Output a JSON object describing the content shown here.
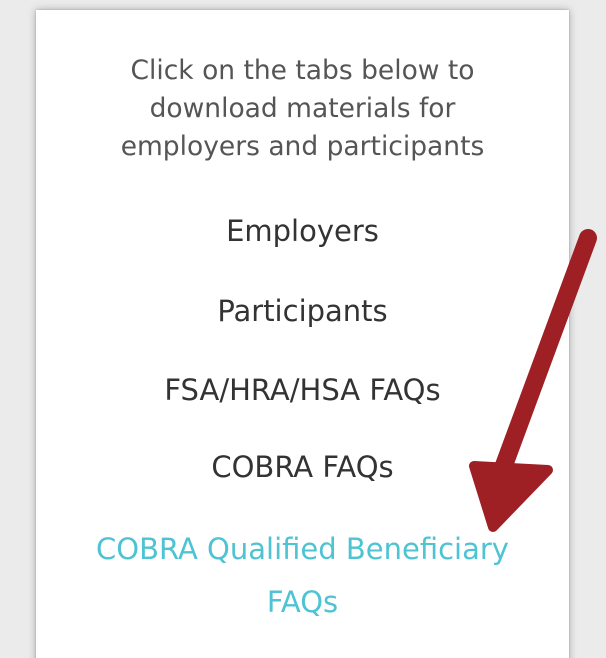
{
  "panel": {
    "intro_lines": [
      "Click on the tabs below to",
      "download materials for",
      "employers and participants"
    ],
    "tabs": [
      {
        "label": "Employers"
      },
      {
        "label": "Participants"
      },
      {
        "label": "FSA/HRA/HSA FAQs"
      },
      {
        "label": "COBRA FAQs"
      },
      {
        "label_lines": [
          "COBRA Qualified Beneficiary",
          "FAQs"
        ]
      }
    ]
  },
  "colors": {
    "active_link": "#4ec3d3",
    "text": "#333333",
    "arrow": "#9e1f24"
  },
  "icons": {
    "pointer": "arrow-icon"
  }
}
